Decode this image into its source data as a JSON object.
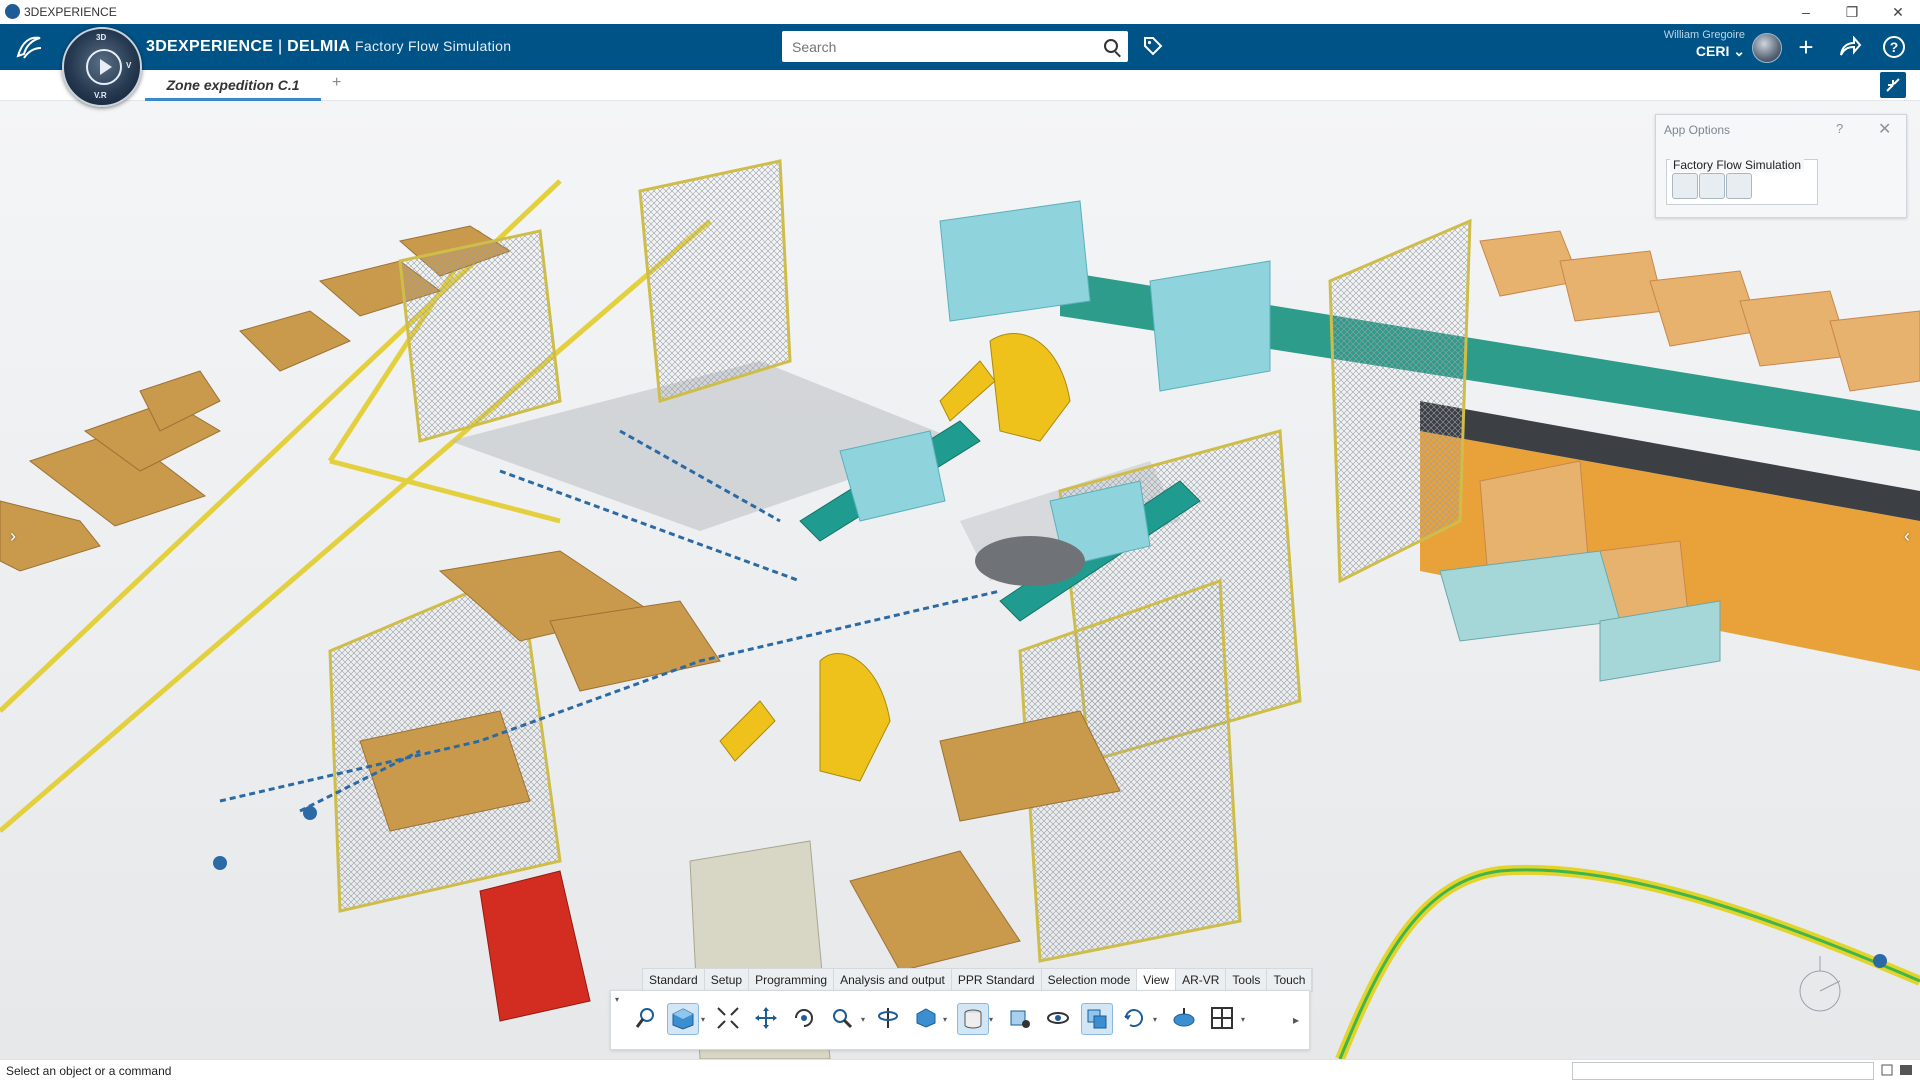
{
  "window": {
    "title": "3DEXPERIENCE",
    "controls": [
      "–",
      "❐",
      "✕"
    ]
  },
  "header": {
    "brand_platform": "3DEXPERIENCE",
    "brand_sep": " | ",
    "brand_company": "DELMIA",
    "brand_app": "Factory Flow Simulation",
    "compass_letters": {
      "top": "3D",
      "left": "",
      "right": "V",
      "bottom": "V.R"
    },
    "search_placeholder": "Search",
    "user_name": "William Gregoire",
    "user_org": "CERI",
    "accent_color": "#005386"
  },
  "tabs": {
    "active": "Zone expedition C.1",
    "add": "+"
  },
  "app_options": {
    "title": "App Options",
    "help": "?",
    "close": "✕",
    "group_label": "Factory Flow Simulation",
    "icons": [
      "globe-person-icon",
      "globe-gear-icon",
      "globe-network-icon"
    ]
  },
  "action_bar": {
    "tabs": [
      "Standard",
      "Setup",
      "Programming",
      "Analysis and output",
      "PPR Standard",
      "Selection mode",
      "View",
      "AR-VR",
      "Tools",
      "Touch"
    ],
    "active_tab": "View",
    "tools": [
      "zoom-area-icon",
      "view-cube-icon",
      "fit-all-icon",
      "pan-icon",
      "rotate-icon",
      "zoom-icon",
      "look-at-icon",
      "normal-view-icon",
      "render-style-icon",
      "hide-show-icon",
      "visibility-icon",
      "swap-visible-icon",
      "refresh-icon",
      "lighting-icon",
      "multi-view-icon"
    ]
  },
  "status": {
    "text": "Select an object or a command"
  }
}
